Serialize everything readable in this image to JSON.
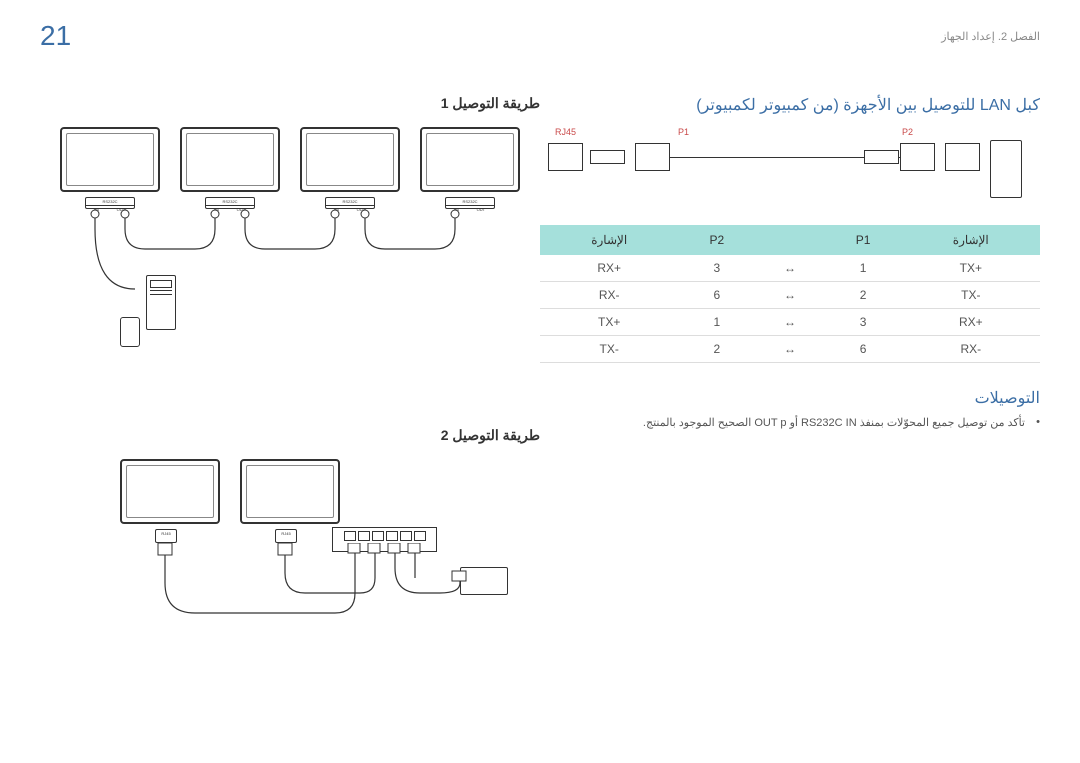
{
  "page_number": "21",
  "chapter": "الفصل 2. إعداد الجهاز",
  "headings": {
    "lan_cable": "كبل LAN للتوصيل بين الأجهزة (من كمبيوتر لكمبيوتر)",
    "method1": "طريقة التوصيل 1",
    "method2": "طريقة التوصيل 2",
    "connections": "التوصيلات"
  },
  "table": {
    "headers": {
      "signal_l": "الإشارة",
      "p2": "P2",
      "blank": "",
      "p1": "P1",
      "signal_r": "الإشارة"
    },
    "rows": [
      {
        "sl": "RX+",
        "p2": "3",
        "ar": "↔",
        "p1": "1",
        "sr": "TX+"
      },
      {
        "sl": "RX-",
        "p2": "6",
        "ar": "↔",
        "p1": "2",
        "sr": "TX-"
      },
      {
        "sl": "TX+",
        "p2": "1",
        "ar": "↔",
        "p1": "3",
        "sr": "RX+"
      },
      {
        "sl": "TX-",
        "p2": "2",
        "ar": "↔",
        "p1": "6",
        "sr": "RX-"
      }
    ]
  },
  "bullet_text": "تأكد من توصيل جميع المحوّلات بمنفذ RS232C IN أو OUT p الصحيح الموجود بالمنتج.",
  "cable_labels": {
    "rj45": "RJ45",
    "p1": "P1",
    "p2": "P2"
  },
  "port_labels": {
    "rs232c": "RS232C",
    "in": "IN",
    "out": "OUT",
    "rj45": "RJ45"
  }
}
